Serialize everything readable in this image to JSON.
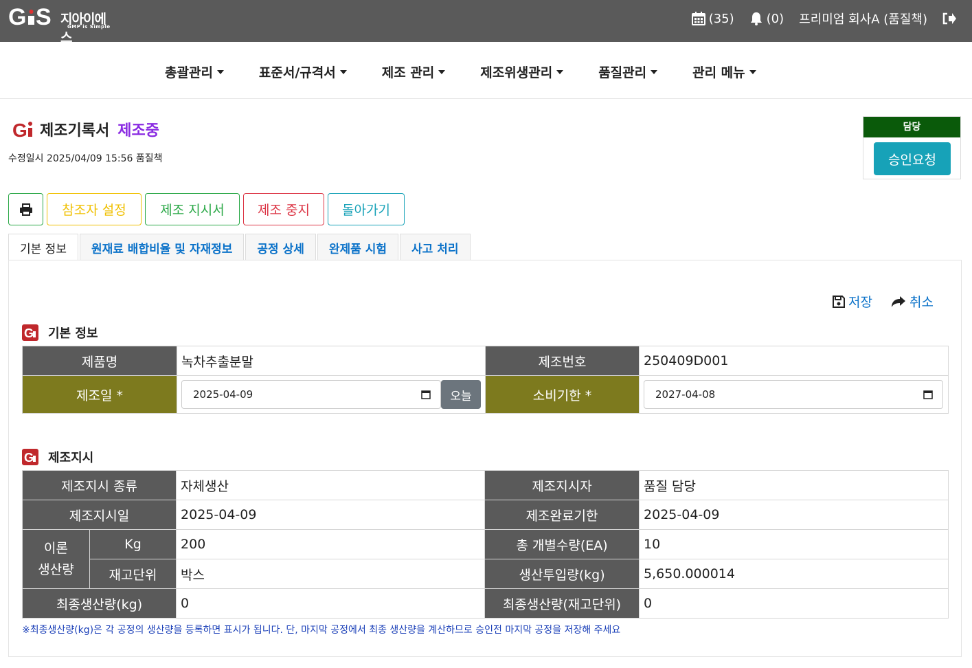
{
  "brand": {
    "name": "지아이에스",
    "tagline": "GMP is Simple"
  },
  "header": {
    "calendar_count": "(35)",
    "notification_count": "(0)",
    "user": "프리미엄 회사A (품질책)"
  },
  "nav": [
    "총괄관리",
    "표준서/규격서",
    "제조 관리",
    "제조위생관리",
    "품질관리",
    "관리 메뉴"
  ],
  "page": {
    "title": "제조기록서",
    "status": "제조중",
    "modified": "수정일시 2025/04/09 15:56  품질책"
  },
  "approval": {
    "header": "담당",
    "button": "승인요청"
  },
  "actions": {
    "reference": "참조자 설정",
    "order": "제조 지시서",
    "stop": "제조 중지",
    "back": "돌아가기"
  },
  "tabs": [
    "기본 정보",
    "원재료 배합비율 및 자재정보",
    "공정 상세",
    "완제품 시험",
    "사고 처리"
  ],
  "panel_actions": {
    "save": "저장",
    "cancel": "취소"
  },
  "basic": {
    "section_title": "기본 정보",
    "product_label": "제품명",
    "product_value": "녹차추출분말",
    "batch_label": "제조번호",
    "batch_value": "250409D001",
    "mfg_date_label": "제조일 *",
    "mfg_date_value": "2025-04-09",
    "today_button": "오늘",
    "expiry_label": "소비기한 *",
    "expiry_value": "2027-04-08"
  },
  "order": {
    "section_title": "제조지시",
    "type_label": "제조지시 종류",
    "type_value": "자체생산",
    "orderer_label": "제조지시자",
    "orderer_value": "품질 담당",
    "order_date_label": "제조지시일",
    "order_date_value": "2025-04-09",
    "deadline_label": "제조완료기한",
    "deadline_value": "2025-04-09",
    "theory_label_1": "이론",
    "theory_label_2": "생산량",
    "kg_label": "Kg",
    "kg_value": "200",
    "total_ea_label": "총 개별수량(EA)",
    "total_ea_value": "10",
    "stock_unit_label": "재고단위",
    "stock_unit_value": "박스",
    "input_label": "생산투입량(kg)",
    "input_value": "5,650.000014",
    "final_kg_label": "최종생산량(kg)",
    "final_kg_value": "0",
    "final_unit_label": "최종생산량(재고단위)",
    "final_unit_value": "0"
  },
  "note": "※최종생산량(kg)은 각 공정의 생산량을 등록하면 표시가 됩니다. 단, 마지막 공정에서 최종 생산량을 계산하므로 승인전 마지막 공정을 저장해 주세요",
  "colors": {
    "topbar": "#5a5a5a",
    "status": "#8a2be2",
    "required_header": "#7d7a1e",
    "approval_header": "#0a5a0a",
    "link": "#0b72c9"
  }
}
